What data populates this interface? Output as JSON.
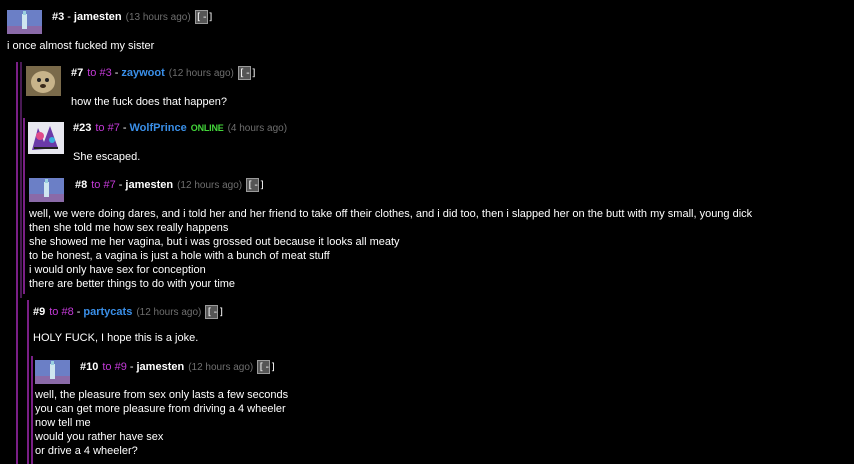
{
  "comments": [
    {
      "num": "#3",
      "to": "",
      "user": "jamesten",
      "status": "",
      "time": "(13 hours ago)",
      "collapse": "[-]",
      "body": "i once almost fucked my sister"
    },
    {
      "num": "#7",
      "to": "to #3",
      "user": "zaywoot",
      "status": "",
      "time": "(12 hours ago)",
      "collapse": "[-]",
      "body": "how the fuck does that happen?"
    },
    {
      "num": "#23",
      "to": "to #7",
      "user": "WolfPrince",
      "status": "ONLINE",
      "time": "(4 hours ago)",
      "collapse": "",
      "body": "She escaped."
    },
    {
      "num": "#8",
      "to": "to #7",
      "user": "jamesten",
      "status": "",
      "time": "(12 hours ago)",
      "collapse": "[-]",
      "body": "well, we were doing dares, and i told her and her friend to take off their clothes, and i did too, then i slapped her on the butt with my small, young dick\nthen she told me how sex really happens\nshe showed me her vagina, but i was grossed out because it looks all meaty\nto be honest, a vagina is just a hole with a bunch of meat stuff\ni would only have sex for conception\nthere are better things to do with your time"
    },
    {
      "num": "#9",
      "to": "to #8",
      "user": "partycats",
      "status": "",
      "time": "(12 hours ago)",
      "collapse": "[-]",
      "body": "HOLY FUCK, I hope this is a joke."
    },
    {
      "num": "#10",
      "to": "to #9",
      "user": "jamesten",
      "status": "",
      "time": "(12 hours ago)",
      "collapse": "[-]",
      "body": "well, the pleasure from sex only lasts a few seconds\nyou can get more pleasure from driving a 4 wheeler\nnow tell me\nwould you rather have sex\nor drive a 4 wheeler?"
    }
  ],
  "colors": {
    "background": "#000000",
    "reply_link": "#c43ad8",
    "username_blue": "#3a8fe8",
    "online": "#43d63a",
    "timestamp": "#6f6f6f",
    "rail": "#7a1f86"
  },
  "icons": {
    "jamesten_avatar": "bottle-avatar-icon",
    "zaywoot_avatar": "animal-photo-avatar-icon",
    "wolfprince_avatar": "cartoon-avatar-icon",
    "partycats_avatar": ""
  }
}
